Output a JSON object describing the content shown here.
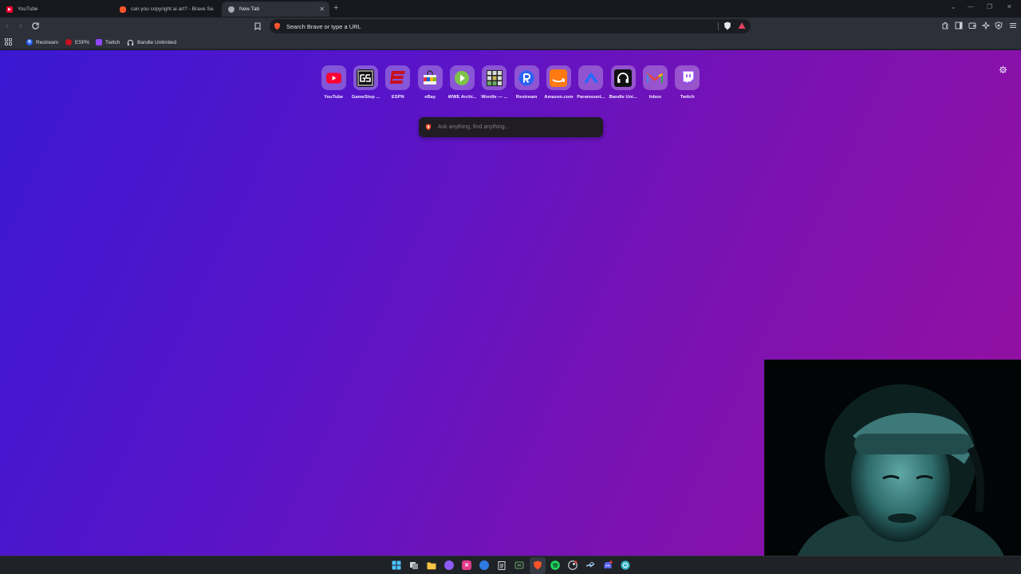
{
  "browser": {
    "tabs": [
      {
        "title": "YouTube",
        "icon": "youtube-icon",
        "active": false
      },
      {
        "title": "can you copyright ai art? - Brave Sea",
        "icon": "brave-search-icon",
        "active": false
      },
      {
        "title": "New Tab",
        "icon": "brave-shield-icon",
        "active": true
      }
    ],
    "new_tab_symbol": "+",
    "window_controls": {
      "chevron": "⌄",
      "minimize": "—",
      "restore": "❐",
      "close": "✕"
    },
    "address_bar": {
      "placeholder": "Search Brave or type a URL"
    },
    "bookmarks": [
      {
        "label": "Restream",
        "icon": "restream-icon",
        "color": "#2a62f5",
        "letter": "R"
      },
      {
        "label": "ESPN",
        "icon": "espn-icon",
        "color": "#c8101e",
        "letter": ""
      },
      {
        "label": "Twitch",
        "icon": "twitch-icon",
        "color": "#9146ff",
        "letter": ""
      },
      {
        "label": "Bandle Unlimited",
        "icon": "headphones-icon",
        "color": "#111111",
        "letter": ""
      }
    ]
  },
  "new_tab_page": {
    "top_sites": [
      {
        "label": "YouTube",
        "icon": "youtube-icon"
      },
      {
        "label": "GameStop ...",
        "icon": "gamestop-icon"
      },
      {
        "label": "ESPN",
        "icon": "espn-icon"
      },
      {
        "label": "eBay",
        "icon": "ebay-bag-icon"
      },
      {
        "label": "WWE Archi...",
        "icon": "play-icon"
      },
      {
        "label": "Wordle — ...",
        "icon": "wordle-grid-icon"
      },
      {
        "label": "Restream",
        "icon": "restream-icon"
      },
      {
        "label": "Amazon.com",
        "icon": "amazon-icon"
      },
      {
        "label": "Paramount...",
        "icon": "paramount-icon"
      },
      {
        "label": "Bandle Uni...",
        "icon": "headphones-icon"
      },
      {
        "label": "Inbox",
        "icon": "gmail-icon"
      },
      {
        "label": "Twitch",
        "icon": "twitch-icon"
      }
    ],
    "search_placeholder": "Ask anything, find anything..."
  },
  "taskbar": {
    "apps": [
      "windows-start-icon",
      "task-view-icon",
      "file-explorer-icon",
      "app-icon-purple",
      "app-icon-pink",
      "app-icon-blue",
      "clipboard-icon",
      "xbox-icon",
      "brave-icon",
      "spotify-icon",
      "steam-badge-icon",
      "steam-icon",
      "discord-icon",
      "app-icon-teal"
    ]
  },
  "colors": {
    "accent": "#7b12b4",
    "youtube": "#ff0033",
    "espn": "#c8101e",
    "twitch": "#9146ff",
    "brave": "#fb542b"
  }
}
